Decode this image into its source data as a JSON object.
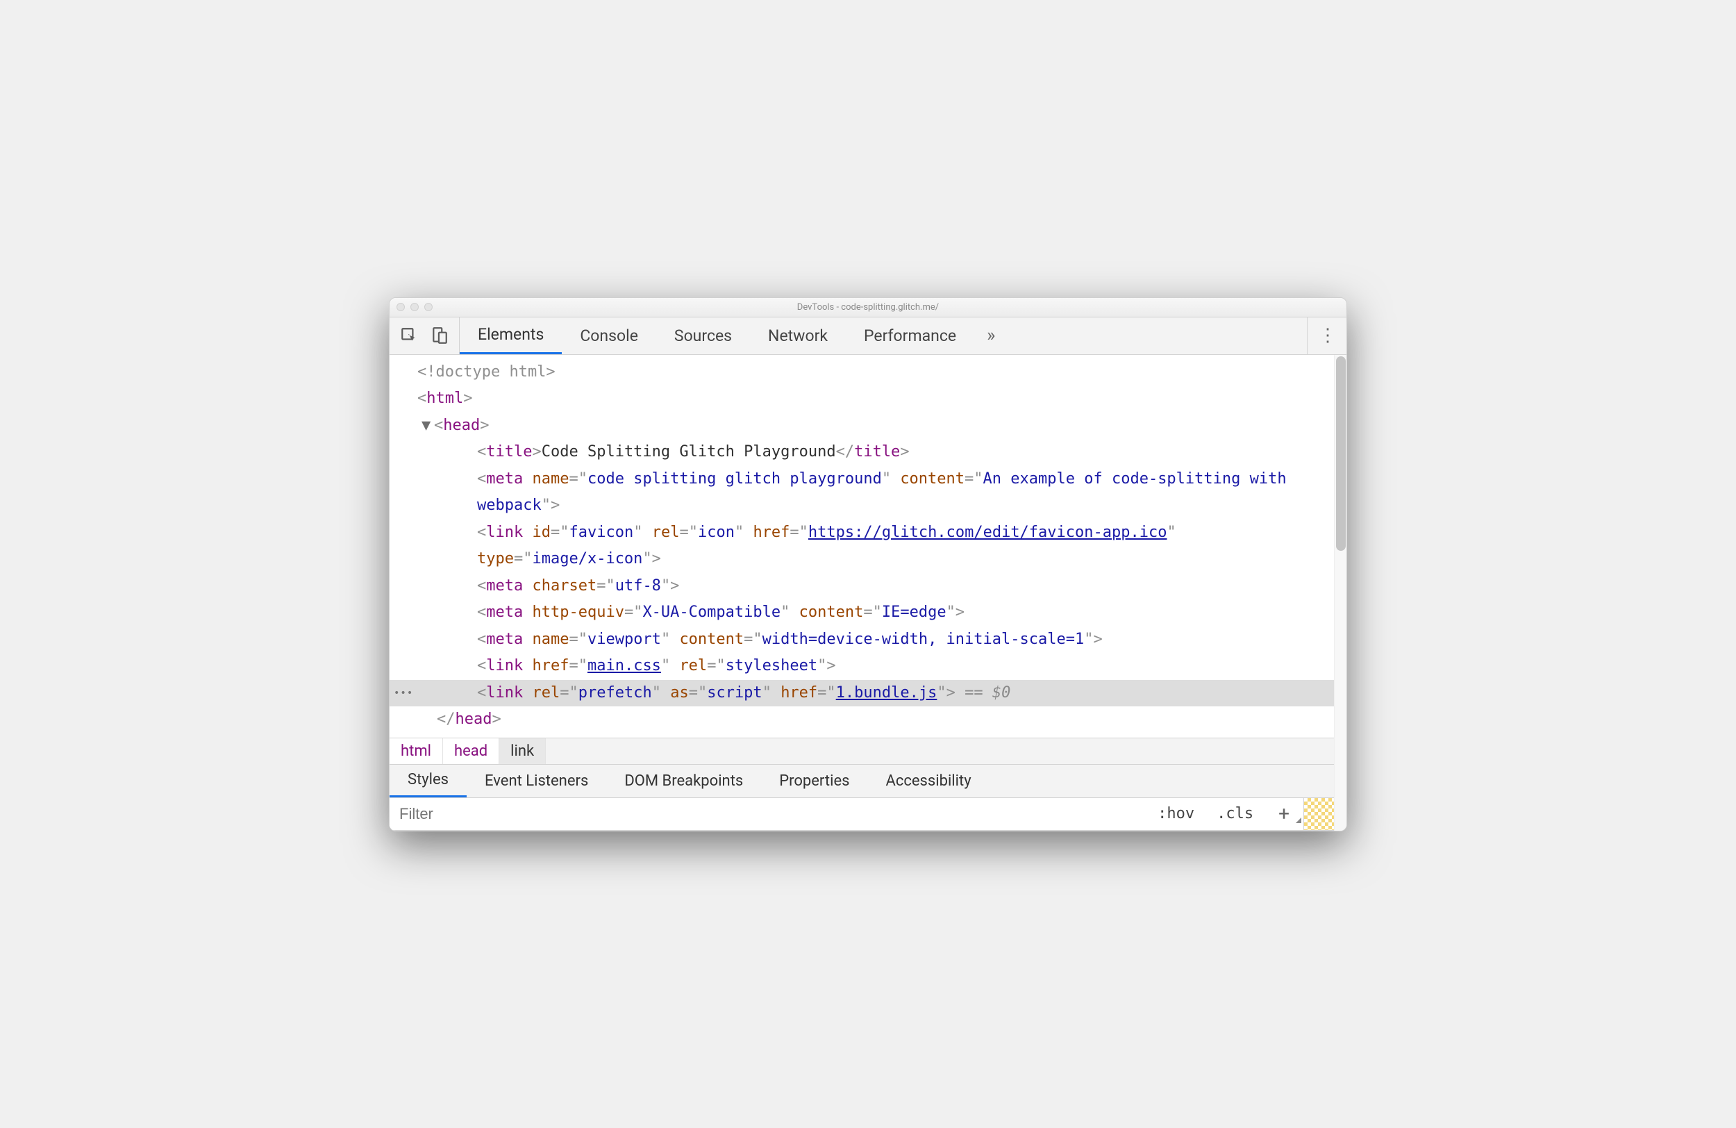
{
  "window": {
    "title": "DevTools - code-splitting.glitch.me/"
  },
  "toolbar": {
    "tabs": [
      "Elements",
      "Console",
      "Sources",
      "Network",
      "Performance"
    ],
    "active_tab": 0
  },
  "dom": {
    "doctype": "<!doctype html>",
    "html_open": "html",
    "head_open": "head",
    "title_tag": "title",
    "title_text": "Code Splitting Glitch Playground",
    "meta1": {
      "tag": "meta",
      "name_attr": "name",
      "name_val": "code splitting glitch playground",
      "content_attr": "content",
      "content_val": "An example of code-splitting with webpack"
    },
    "link1": {
      "tag": "link",
      "id_attr": "id",
      "id_val": "favicon",
      "rel_attr": "rel",
      "rel_val": "icon",
      "href_attr": "href",
      "href_val": "https://glitch.com/edit/favicon-app.ico",
      "type_attr": "type",
      "type_val": "image/x-icon"
    },
    "meta2": {
      "tag": "meta",
      "charset_attr": "charset",
      "charset_val": "utf-8"
    },
    "meta3": {
      "tag": "meta",
      "httpequiv_attr": "http-equiv",
      "httpequiv_val": "X-UA-Compatible",
      "content_attr": "content",
      "content_val": "IE=edge"
    },
    "meta4": {
      "tag": "meta",
      "name_attr": "name",
      "name_val": "viewport",
      "content_attr": "content",
      "content_val": "width=device-width, initial-scale=1"
    },
    "link2": {
      "tag": "link",
      "href_attr": "href",
      "href_val": "main.css",
      "rel_attr": "rel",
      "rel_val": "stylesheet"
    },
    "link3": {
      "tag": "link",
      "rel_attr": "rel",
      "rel_val": "prefetch",
      "as_attr": "as",
      "as_val": "script",
      "href_attr": "href",
      "href_val": "1.bundle.js"
    },
    "sel_marker": " == $0",
    "head_close": "head"
  },
  "crumbs": [
    "html",
    "head",
    "link"
  ],
  "sub_tabs": [
    "Styles",
    "Event Listeners",
    "DOM Breakpoints",
    "Properties",
    "Accessibility"
  ],
  "filter": {
    "placeholder": "Filter",
    "hov": ":hov",
    "cls": ".cls"
  }
}
